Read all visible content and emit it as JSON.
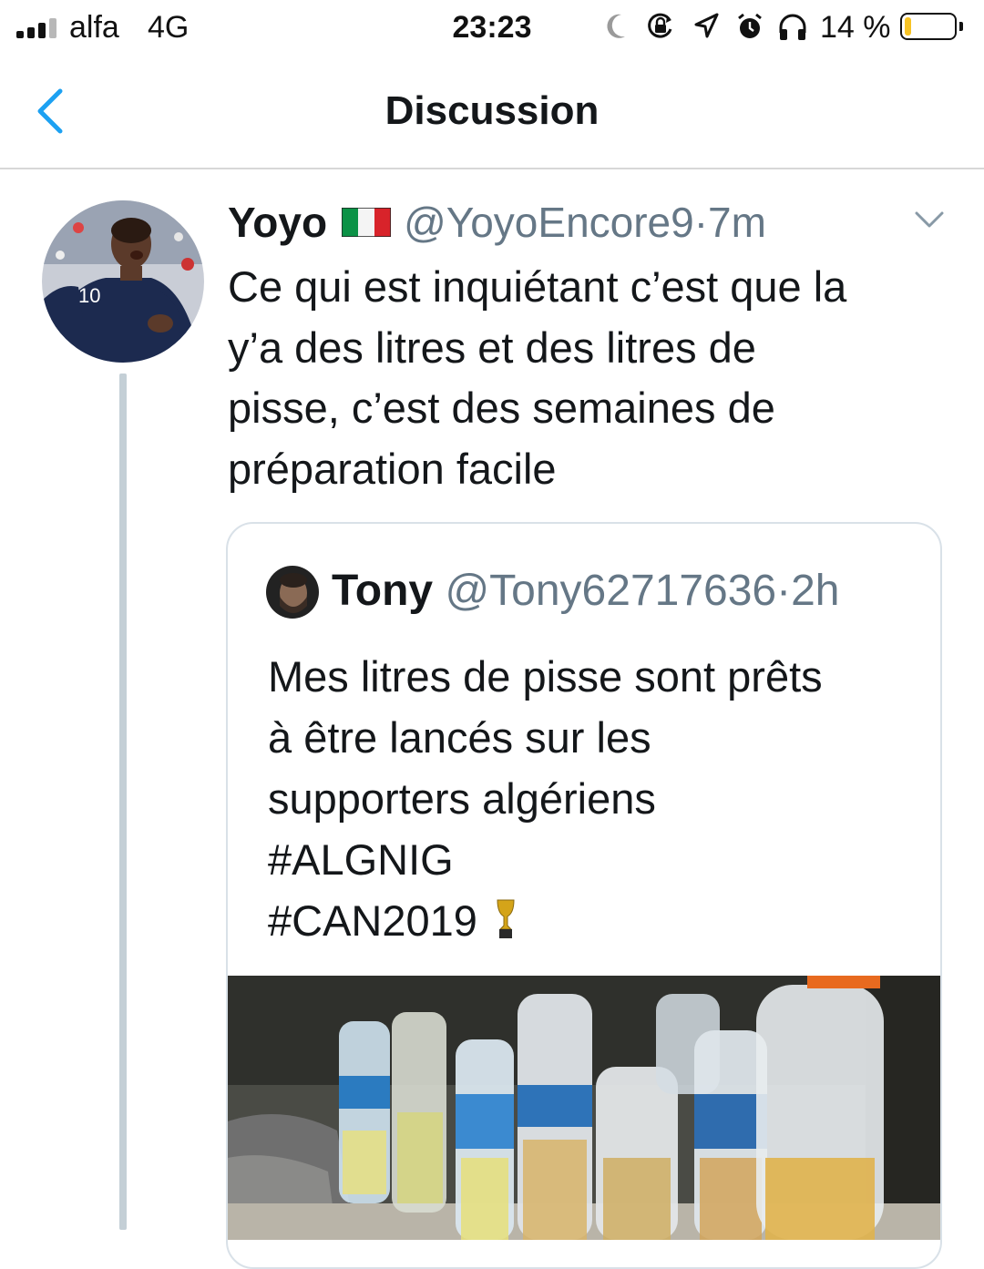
{
  "status_bar": {
    "carrier": "alfa",
    "network": "4G",
    "time": "23:23",
    "battery_percent": "14 %",
    "battery_level": 0.14,
    "signal_bars_active": 3,
    "icons": [
      "moon-icon",
      "orientation-lock-icon",
      "location-icon",
      "alarm-icon",
      "headphones-icon",
      "battery-icon"
    ]
  },
  "nav": {
    "title": "Discussion",
    "back_icon": "chevron-left-icon",
    "accent_color": "#1da1f2"
  },
  "tweet": {
    "author_name": "Yoyo",
    "flag": "italy-flag",
    "handle": "@YoyoEncore9",
    "separator": "·",
    "time": "7m",
    "menu_icon": "chevron-down-icon",
    "body_lines": [
      "Ce qui est inquiétant c’est que la",
      "y’a des litres et des litres de",
      "pisse, c’est des semaines de",
      "préparation facile"
    ]
  },
  "quoted_tweet": {
    "author_name": "Tony",
    "handle": "@Tony62717636",
    "separator": "·",
    "time": "2h",
    "body_lines": [
      "Mes litres de pisse sont prêts",
      "à être lancés sur les",
      "supporters algériens",
      "#ALGNIG",
      "#CAN2019"
    ],
    "emoji": "trophy-icon"
  },
  "colors": {
    "text_primary": "#14171a",
    "text_secondary": "#657786",
    "divider": "#d9e1e8",
    "thread_line": "#c4cfd6"
  }
}
